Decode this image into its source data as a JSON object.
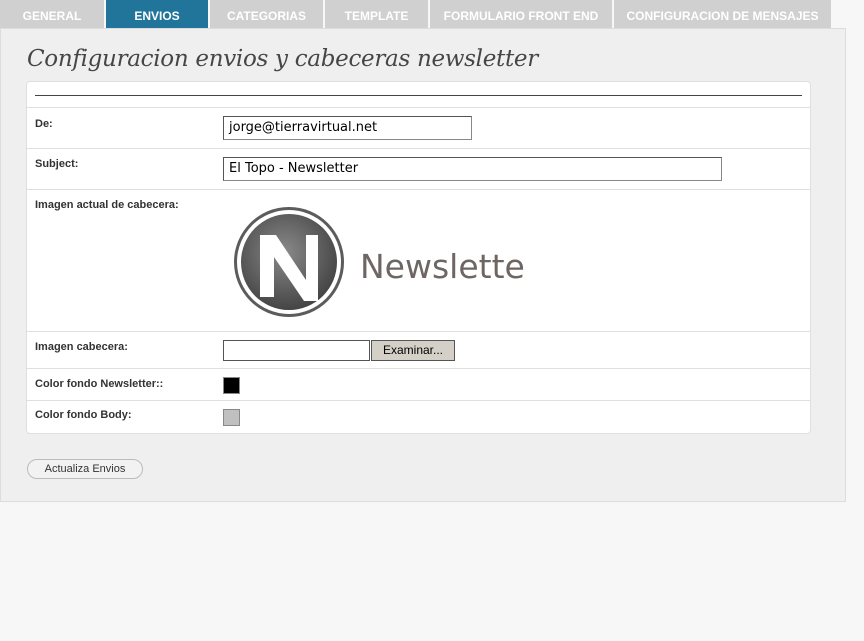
{
  "tabs": [
    {
      "label": "GENERAL",
      "active": false
    },
    {
      "label": "ENVIOS",
      "active": true
    },
    {
      "label": "CATEGORIAS",
      "active": false
    },
    {
      "label": "TEMPLATE",
      "active": false
    },
    {
      "label": "FORMULARIO FRONT END",
      "active": false
    },
    {
      "label": "CONFIGURACION DE MENSAJES",
      "active": false
    }
  ],
  "page": {
    "title": "Configuracion envios y cabeceras newsletter"
  },
  "form": {
    "from": {
      "label": "De:",
      "value": "jorge@tierravirtual.net"
    },
    "subject": {
      "label": "Subject:",
      "value": "El Topo - Newsletter"
    },
    "current_header": {
      "label": "Imagen actual de cabecera:",
      "image_text": "Newsletter",
      "image_letter": "N"
    },
    "header_upload": {
      "label": "Imagen cabecera:",
      "button_label": "Examinar..."
    },
    "newsletter_bg": {
      "label": "Color fondo Newsletter::",
      "color": "#000000"
    },
    "body_bg": {
      "label": "Color fondo Body:",
      "color": "#c0c0c0"
    }
  },
  "submit": {
    "label": "Actualiza Envios"
  },
  "colors": {
    "accent": "#21759b",
    "tab_inactive": "#d0d0d0"
  }
}
